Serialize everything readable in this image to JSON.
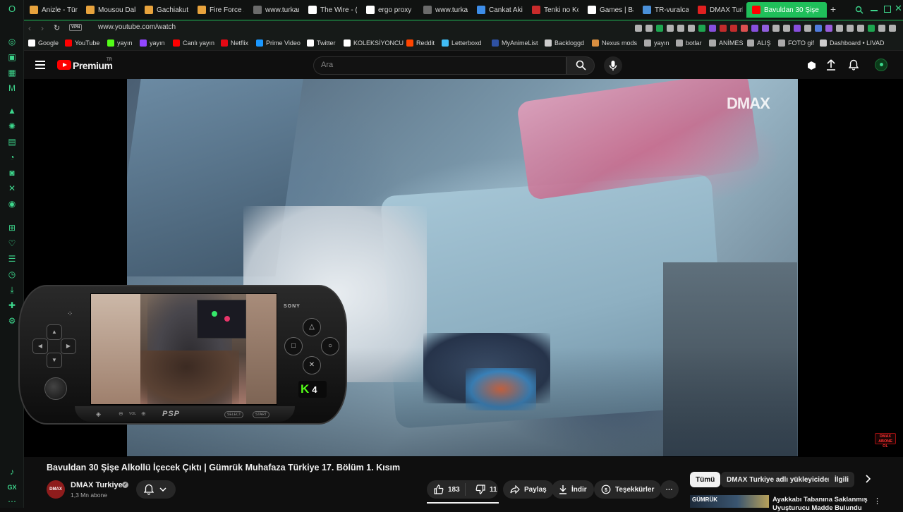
{
  "browser": {
    "tabs": [
      {
        "label": "Anizle - Türk",
        "color": "#e8a33d"
      },
      {
        "label": "Mousou Dak",
        "color": "#e8a33d"
      },
      {
        "label": "Gachiakuta",
        "color": "#e8a33d"
      },
      {
        "label": "Fire Force 2",
        "color": "#e8a33d"
      },
      {
        "label": "www.turkan",
        "color": "#6b6b6b"
      },
      {
        "label": "The Wire - (",
        "color": "#ffffff"
      },
      {
        "label": "ergo proxy",
        "color": "#ffffff"
      },
      {
        "label": "www.turkan",
        "color": "#6b6b6b"
      },
      {
        "label": "Cankat Aki's",
        "color": "#3d8de8"
      },
      {
        "label": "Tenki no Ko",
        "color": "#c92b2b"
      },
      {
        "label": "Games | Ba",
        "color": "#ffffff"
      },
      {
        "label": "TR-vuralcan",
        "color": "#4a90d9"
      },
      {
        "label": "DMAX Turk",
        "color": "#e02020"
      },
      {
        "label": "Bavuldan 30 Şişe",
        "color": "#ff0000"
      }
    ],
    "new_tab_label": "+",
    "address": {
      "vpn_label": "VPN",
      "url": "www.youtube.com/watch"
    },
    "bookmarks": [
      {
        "label": "Google",
        "color": "#ffffff"
      },
      {
        "label": "YouTube",
        "color": "#ff0000"
      },
      {
        "label": "yayın",
        "color": "#53fc18"
      },
      {
        "label": "yayın",
        "color": "#9146ff"
      },
      {
        "label": "Canlı yayın",
        "color": "#ff0000"
      },
      {
        "label": "Netflix",
        "color": "#e50914"
      },
      {
        "label": "Prime Video",
        "color": "#1a98ff"
      },
      {
        "label": "Twitter",
        "color": "#ffffff"
      },
      {
        "label": "KOLEKSİYONCU",
        "color": "#ffffff"
      },
      {
        "label": "Reddit",
        "color": "#ff4500"
      },
      {
        "label": "Letterboxd",
        "color": "#40bcf4"
      },
      {
        "label": "MyAnimeList",
        "color": "#2e51a2"
      },
      {
        "label": "Backloggd",
        "color": "#cccccc"
      },
      {
        "label": "Nexus mods",
        "color": "#d98f40"
      },
      {
        "label": "yayın",
        "color": "#aaaaaa"
      },
      {
        "label": "botlar",
        "color": "#aaaaaa"
      },
      {
        "label": "ANİMES",
        "color": "#aaaaaa"
      },
      {
        "label": "ALIŞ",
        "color": "#aaaaaa"
      },
      {
        "label": "FOTO gif",
        "color": "#aaaaaa"
      },
      {
        "label": "Dashboard • LIVAD",
        "color": "#cccccc"
      }
    ],
    "accent": "#1fbf5a"
  },
  "youtube": {
    "logo_text": "Premium",
    "logo_region": "TR",
    "search_placeholder": "Ara",
    "video": {
      "watermark": "DMAX",
      "corner_badge": "DMAX ABONE OL",
      "title": "Bavuldan 30 Şişe Alkollü İçecek Çıktı | Gümrük Muhafaza Türkiye 17. Bölüm 1. Kısım"
    },
    "channel": {
      "avatar_text": "DMAX",
      "name": "DMAX Turkiye",
      "subscribers": "1,3 Mn abone"
    },
    "actions": {
      "likes": "183",
      "dislikes": "11",
      "share": "Paylaş",
      "download": "İndir",
      "thanks": "Teşekkürler"
    },
    "chips": [
      "Tümü",
      "DMAX Turkiye adlı yükleyiciden",
      "İlgili"
    ],
    "recommended": {
      "title": "Ayakkabı Tabanına Saklanmış",
      "title_line2": "Uyuşturucu Madde Bulundu",
      "thumb_text": "GÜMRÜK"
    }
  },
  "psp": {
    "brand": "SONY",
    "logo": "PSP",
    "vol_label": "VOL",
    "select_label": "SELECT",
    "start_label": "START",
    "kick_badge": "K",
    "kick_number": "4"
  }
}
